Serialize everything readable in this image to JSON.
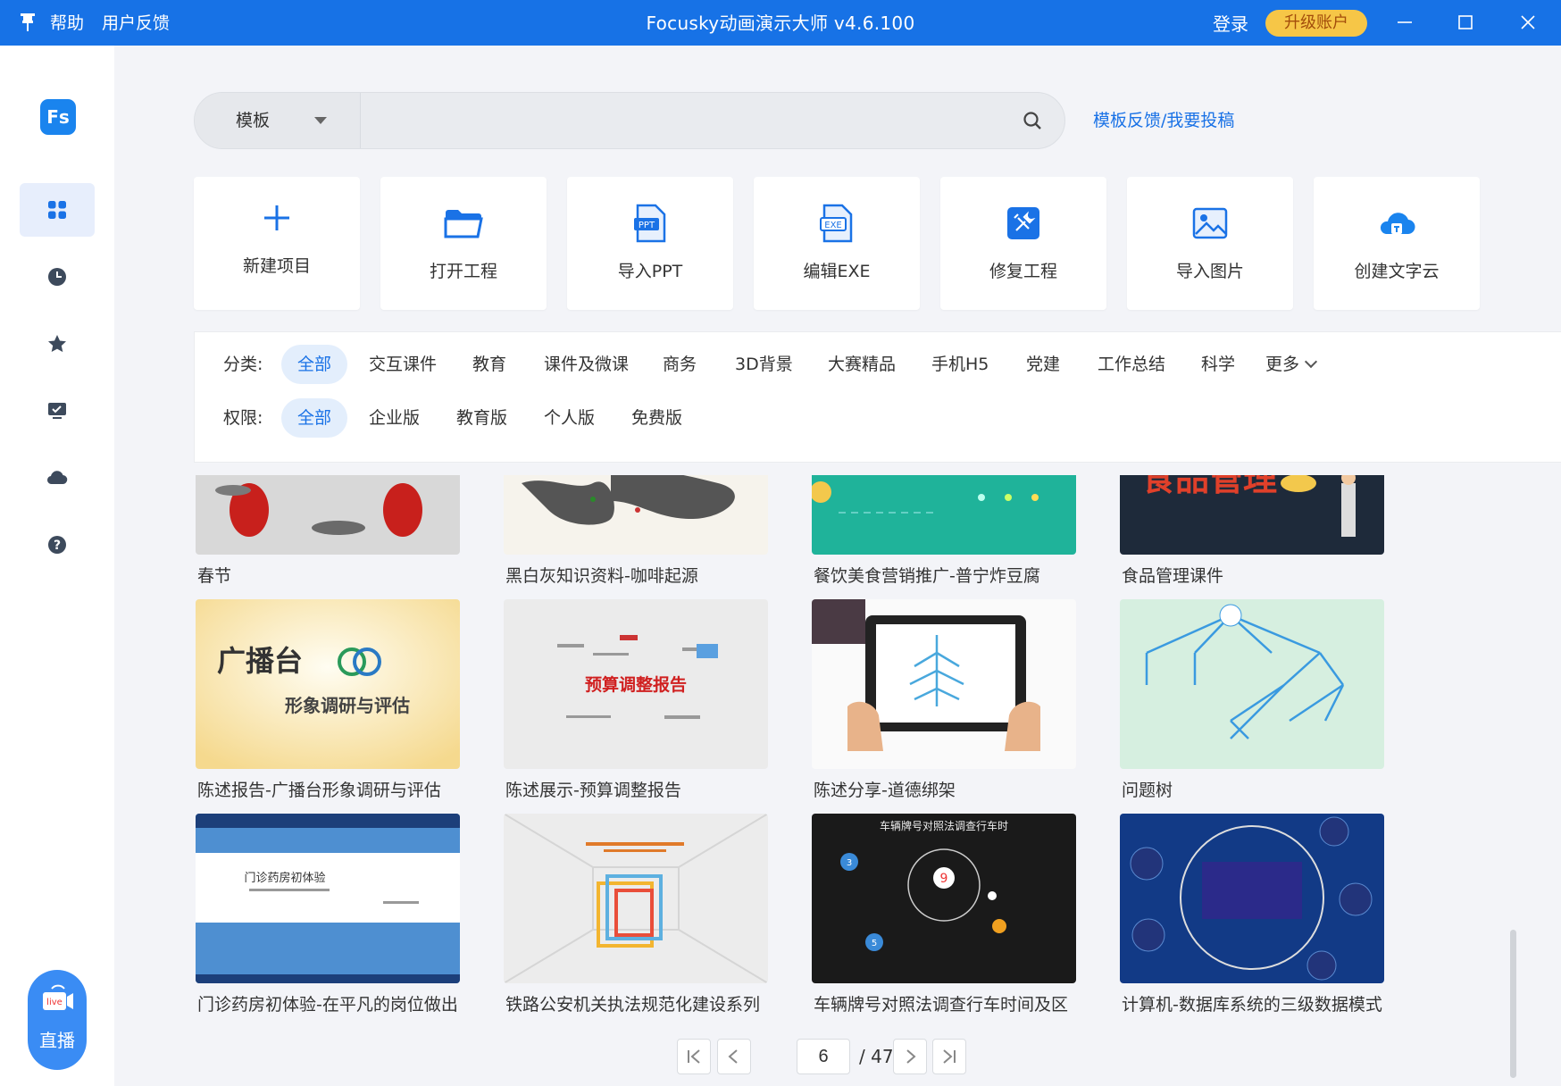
{
  "titlebar": {
    "menu": [
      "帮助",
      "用户反馈"
    ],
    "title": "Focusky动画演示大师 v4.6.100",
    "login": "登录",
    "upgrade": "升级账户"
  },
  "sidebar": {
    "logo": "Fs",
    "items": [
      {
        "icon": "grid-icon",
        "active": true
      },
      {
        "icon": "clock-icon",
        "active": false
      },
      {
        "icon": "star-icon",
        "active": false
      },
      {
        "icon": "presentation-icon",
        "active": false
      },
      {
        "icon": "cloud-icon",
        "active": false
      },
      {
        "icon": "help-icon",
        "active": false
      }
    ],
    "live_badge": "live",
    "live_label": "直播"
  },
  "search": {
    "category": "模板",
    "placeholder": "",
    "feedback_link": "模板反馈/我要投稿"
  },
  "actions": [
    {
      "label": "新建项目",
      "icon": "plus-icon"
    },
    {
      "label": "打开工程",
      "icon": "folder-icon"
    },
    {
      "label": "导入PPT",
      "icon": "ppt-file-icon"
    },
    {
      "label": "编辑EXE",
      "icon": "exe-file-icon"
    },
    {
      "label": "修复工程",
      "icon": "repair-icon"
    },
    {
      "label": "导入图片",
      "icon": "image-icon"
    },
    {
      "label": "创建文字云",
      "icon": "cloud-text-icon"
    }
  ],
  "filters": {
    "category_label": "分类:",
    "categories": [
      "全部",
      "交互课件",
      "教育",
      "课件及微课",
      "商务",
      "3D背景",
      "大赛精品",
      "手机H5",
      "党建",
      "工作总结",
      "科学",
      "更多"
    ],
    "category_selected": "全部",
    "permission_label": "权限:",
    "permissions": [
      "全部",
      "企业版",
      "教育版",
      "个人版",
      "免费版"
    ],
    "permission_selected": "全部"
  },
  "templates": [
    {
      "name": "春节",
      "thumb_text": ""
    },
    {
      "name": "黑白灰知识资料-咖啡起源",
      "thumb_text": ""
    },
    {
      "name": "餐饮美食营销推广-普宁炸豆腐",
      "thumb_text": ""
    },
    {
      "name": "食品管理课件",
      "thumb_text": "食品管理"
    },
    {
      "name": "陈述报告-广播台形象调研与评估",
      "thumb_text": "广播台",
      "thumb_sub": "形象调研与评估"
    },
    {
      "name": "陈述展示-预算调整报告",
      "thumb_text": "预算调整报告"
    },
    {
      "name": "陈述分享-道德绑架",
      "thumb_text": ""
    },
    {
      "name": "问题树",
      "thumb_text": ""
    },
    {
      "name": "门诊药房初体验-在平凡的岗位做出",
      "thumb_text": "门诊药房初体验"
    },
    {
      "name": "铁路公安机关执法规范化建设系列",
      "thumb_text": ""
    },
    {
      "name": "车辆牌号对照法调查行车时间及区",
      "thumb_text": "车辆牌号对照法调查行车时",
      "thumb_num_a": "9",
      "thumb_num_b": "3",
      "thumb_num_c": "5"
    },
    {
      "name": "计算机-数据库系统的三级数据模式",
      "thumb_text": ""
    }
  ],
  "pager": {
    "current": "6",
    "total": "/ 47"
  },
  "colors": {
    "accent": "#1772e6",
    "upgrade": "#f6c647"
  }
}
